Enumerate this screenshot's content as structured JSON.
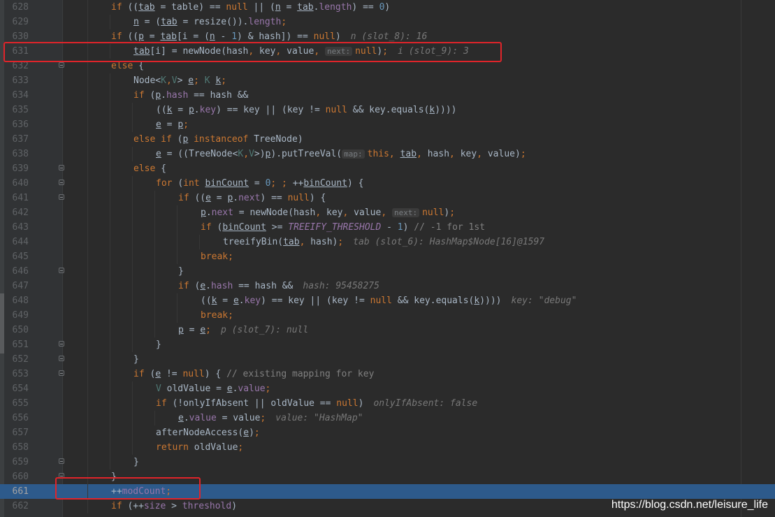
{
  "editor": {
    "language": "java",
    "current_line": 661,
    "lines": [
      {
        "n": "628",
        "indent": 2,
        "fold": false,
        "tokens": [
          [
            "kw",
            "if "
          ],
          [
            "p",
            "(("
          ],
          [
            "vu",
            "tab"
          ],
          [
            "p",
            " = table) == "
          ],
          [
            "kw",
            "null"
          ],
          [
            "p",
            " || ("
          ],
          [
            "vu",
            "n"
          ],
          [
            "p",
            " = "
          ],
          [
            "vu",
            "tab"
          ],
          [
            "p",
            "."
          ],
          [
            "fld",
            "length"
          ],
          [
            "p",
            ") == "
          ],
          [
            "num",
            "0"
          ],
          [
            "p",
            ")"
          ]
        ]
      },
      {
        "n": "629",
        "indent": 3,
        "fold": false,
        "tokens": [
          [
            "vu",
            "n"
          ],
          [
            "p",
            " = ("
          ],
          [
            "vu",
            "tab"
          ],
          [
            "p",
            " = resize())."
          ],
          [
            "fld",
            "length"
          ],
          [
            "kw",
            ";"
          ]
        ]
      },
      {
        "n": "630",
        "indent": 2,
        "fold": false,
        "tokens": [
          [
            "kw",
            "if "
          ],
          [
            "p",
            "(("
          ],
          [
            "vu",
            "p"
          ],
          [
            "p",
            " = "
          ],
          [
            "vu",
            "tab"
          ],
          [
            "p",
            "[i = ("
          ],
          [
            "vu",
            "n"
          ],
          [
            "p",
            " - "
          ],
          [
            "num",
            "1"
          ],
          [
            "p",
            ") & hash]) == "
          ],
          [
            "kw",
            "null"
          ],
          [
            "p",
            ")"
          ],
          [
            "inl",
            "n (slot_8): 16"
          ]
        ]
      },
      {
        "n": "631",
        "indent": 3,
        "fold": false,
        "tokens": [
          [
            "vu",
            "tab"
          ],
          [
            "p",
            "[i] = newNode(hash"
          ],
          [
            "kw",
            ", "
          ],
          [
            "p",
            "key"
          ],
          [
            "kw",
            ", "
          ],
          [
            "p",
            "value"
          ],
          [
            "kw",
            ", "
          ],
          [
            "hint",
            "next:"
          ],
          [
            "kw",
            "null"
          ],
          [
            "p",
            ")"
          ],
          [
            "kw",
            ";"
          ],
          [
            "inl",
            "i (slot_9): 3"
          ]
        ]
      },
      {
        "n": "632",
        "indent": 2,
        "fold": true,
        "tokens": [
          [
            "kw",
            "else "
          ],
          [
            "p",
            "{"
          ]
        ]
      },
      {
        "n": "633",
        "indent": 3,
        "fold": false,
        "tokens": [
          [
            "p",
            "Node<"
          ],
          [
            "gen",
            "K"
          ],
          [
            "kw",
            ","
          ],
          [
            "gen",
            "V"
          ],
          [
            "p",
            "> "
          ],
          [
            "vu",
            "e"
          ],
          [
            "kw",
            "; "
          ],
          [
            "gen",
            "K "
          ],
          [
            "vu",
            "k"
          ],
          [
            "kw",
            ";"
          ]
        ]
      },
      {
        "n": "634",
        "indent": 3,
        "fold": false,
        "tokens": [
          [
            "kw",
            "if "
          ],
          [
            "p",
            "("
          ],
          [
            "vu",
            "p"
          ],
          [
            "p",
            "."
          ],
          [
            "fld",
            "hash"
          ],
          [
            "p",
            " == hash &&"
          ]
        ]
      },
      {
        "n": "635",
        "indent": 4,
        "fold": false,
        "tokens": [
          [
            "p",
            "(("
          ],
          [
            "vu",
            "k"
          ],
          [
            "p",
            " = "
          ],
          [
            "vu",
            "p"
          ],
          [
            "p",
            "."
          ],
          [
            "fld",
            "key"
          ],
          [
            "p",
            ") == key || (key != "
          ],
          [
            "kw",
            "null"
          ],
          [
            "p",
            " && key.equals("
          ],
          [
            "vu",
            "k"
          ],
          [
            "p",
            "))))"
          ]
        ]
      },
      {
        "n": "636",
        "indent": 4,
        "fold": false,
        "tokens": [
          [
            "vu",
            "e"
          ],
          [
            "p",
            " = "
          ],
          [
            "vu",
            "p"
          ],
          [
            "kw",
            ";"
          ]
        ]
      },
      {
        "n": "637",
        "indent": 3,
        "fold": false,
        "tokens": [
          [
            "kw",
            "else if "
          ],
          [
            "p",
            "("
          ],
          [
            "vu",
            "p"
          ],
          [
            "kw",
            " instanceof "
          ],
          [
            "p",
            "TreeNode)"
          ]
        ]
      },
      {
        "n": "638",
        "indent": 4,
        "fold": false,
        "tokens": [
          [
            "vu",
            "e"
          ],
          [
            "p",
            " = ((TreeNode<"
          ],
          [
            "gen",
            "K"
          ],
          [
            "kw",
            ","
          ],
          [
            "gen",
            "V"
          ],
          [
            "p",
            ">)"
          ],
          [
            "vu",
            "p"
          ],
          [
            "p",
            ").putTreeVal("
          ],
          [
            "hint",
            "map:"
          ],
          [
            "kw",
            "this, "
          ],
          [
            "vu",
            "tab"
          ],
          [
            "kw",
            ", "
          ],
          [
            "p",
            "hash"
          ],
          [
            "kw",
            ", "
          ],
          [
            "p",
            "key"
          ],
          [
            "kw",
            ", "
          ],
          [
            "p",
            "value)"
          ],
          [
            "kw",
            ";"
          ]
        ]
      },
      {
        "n": "639",
        "indent": 3,
        "fold": true,
        "tokens": [
          [
            "kw",
            "else "
          ],
          [
            "p",
            "{"
          ]
        ]
      },
      {
        "n": "640",
        "indent": 4,
        "fold": true,
        "tokens": [
          [
            "kw",
            "for "
          ],
          [
            "p",
            "("
          ],
          [
            "kw",
            "int "
          ],
          [
            "vu",
            "binCount"
          ],
          [
            "p",
            " = "
          ],
          [
            "num",
            "0"
          ],
          [
            "kw",
            "; ; "
          ],
          [
            "p",
            "++"
          ],
          [
            "vu",
            "binCount"
          ],
          [
            "p",
            ") {"
          ]
        ]
      },
      {
        "n": "641",
        "indent": 5,
        "fold": true,
        "tokens": [
          [
            "kw",
            "if "
          ],
          [
            "p",
            "(("
          ],
          [
            "vu",
            "e"
          ],
          [
            "p",
            " = "
          ],
          [
            "vu",
            "p"
          ],
          [
            "p",
            "."
          ],
          [
            "fld",
            "next"
          ],
          [
            "p",
            ") == "
          ],
          [
            "kw",
            "null"
          ],
          [
            "p",
            ") {"
          ]
        ]
      },
      {
        "n": "642",
        "indent": 6,
        "fold": false,
        "tokens": [
          [
            "vu",
            "p"
          ],
          [
            "p",
            "."
          ],
          [
            "fld",
            "next"
          ],
          [
            "p",
            " = newNode(hash"
          ],
          [
            "kw",
            ", "
          ],
          [
            "p",
            "key"
          ],
          [
            "kw",
            ", "
          ],
          [
            "p",
            "value"
          ],
          [
            "kw",
            ", "
          ],
          [
            "hint",
            "next:"
          ],
          [
            "kw",
            "null"
          ],
          [
            "p",
            ")"
          ],
          [
            "kw",
            ";"
          ]
        ]
      },
      {
        "n": "643",
        "indent": 6,
        "fold": false,
        "tokens": [
          [
            "kw",
            "if "
          ],
          [
            "p",
            "("
          ],
          [
            "vu",
            "binCount"
          ],
          [
            "p",
            " >= "
          ],
          [
            "cst",
            "TREEIFY_THRESHOLD"
          ],
          [
            "p",
            " - "
          ],
          [
            "num",
            "1"
          ],
          [
            "p",
            ") "
          ],
          [
            "cmt",
            "// -1 for 1st"
          ]
        ]
      },
      {
        "n": "644",
        "indent": 7,
        "fold": false,
        "tokens": [
          [
            "p",
            "treeifyBin("
          ],
          [
            "vu",
            "tab"
          ],
          [
            "kw",
            ", "
          ],
          [
            "p",
            "hash)"
          ],
          [
            "kw",
            ";"
          ],
          [
            "inl",
            "tab (slot_6): HashMap$Node[16]@1597"
          ]
        ]
      },
      {
        "n": "645",
        "indent": 6,
        "fold": false,
        "tokens": [
          [
            "kw",
            "break;"
          ]
        ]
      },
      {
        "n": "646",
        "indent": 5,
        "fold": true,
        "tokens": [
          [
            "p",
            "}"
          ]
        ]
      },
      {
        "n": "647",
        "indent": 5,
        "fold": false,
        "tokens": [
          [
            "kw",
            "if "
          ],
          [
            "p",
            "("
          ],
          [
            "vu",
            "e"
          ],
          [
            "p",
            "."
          ],
          [
            "fld",
            "hash"
          ],
          [
            "p",
            " == hash &&"
          ],
          [
            "inl",
            "hash: 95458275"
          ]
        ]
      },
      {
        "n": "648",
        "indent": 6,
        "fold": false,
        "tokens": [
          [
            "p",
            "(("
          ],
          [
            "vu",
            "k"
          ],
          [
            "p",
            " = "
          ],
          [
            "vu",
            "e"
          ],
          [
            "p",
            "."
          ],
          [
            "fld",
            "key"
          ],
          [
            "p",
            ") == key || (key != "
          ],
          [
            "kw",
            "null"
          ],
          [
            "p",
            " && key.equals("
          ],
          [
            "vu",
            "k"
          ],
          [
            "p",
            "))))"
          ],
          [
            "inl",
            "key: \"debug\""
          ]
        ]
      },
      {
        "n": "649",
        "indent": 6,
        "fold": false,
        "tokens": [
          [
            "kw",
            "break;"
          ]
        ]
      },
      {
        "n": "650",
        "indent": 5,
        "fold": false,
        "tokens": [
          [
            "vu",
            "p"
          ],
          [
            "p",
            " = "
          ],
          [
            "vu",
            "e"
          ],
          [
            "kw",
            ";"
          ],
          [
            "inl",
            "p (slot_7): null"
          ]
        ]
      },
      {
        "n": "651",
        "indent": 4,
        "fold": true,
        "tokens": [
          [
            "p",
            "}"
          ]
        ]
      },
      {
        "n": "652",
        "indent": 3,
        "fold": true,
        "tokens": [
          [
            "p",
            "}"
          ]
        ]
      },
      {
        "n": "653",
        "indent": 3,
        "fold": true,
        "tokens": [
          [
            "kw",
            "if "
          ],
          [
            "p",
            "("
          ],
          [
            "vu",
            "e"
          ],
          [
            "p",
            " != "
          ],
          [
            "kw",
            "null"
          ],
          [
            "p",
            ") { "
          ],
          [
            "cmt",
            "// existing mapping for key"
          ]
        ]
      },
      {
        "n": "654",
        "indent": 4,
        "fold": false,
        "tokens": [
          [
            "gen",
            "V "
          ],
          [
            "p",
            "oldValue = "
          ],
          [
            "vu",
            "e"
          ],
          [
            "p",
            "."
          ],
          [
            "fld",
            "value"
          ],
          [
            "kw",
            ";"
          ]
        ]
      },
      {
        "n": "655",
        "indent": 4,
        "fold": false,
        "tokens": [
          [
            "kw",
            "if "
          ],
          [
            "p",
            "(!onlyIfAbsent || oldValue == "
          ],
          [
            "kw",
            "null"
          ],
          [
            "p",
            ")"
          ],
          [
            "inl",
            "onlyIfAbsent: false"
          ]
        ]
      },
      {
        "n": "656",
        "indent": 5,
        "fold": false,
        "tokens": [
          [
            "vu",
            "e"
          ],
          [
            "p",
            "."
          ],
          [
            "fld",
            "value"
          ],
          [
            "p",
            " = value"
          ],
          [
            "kw",
            ";"
          ],
          [
            "inl",
            "value: \"HashMap\""
          ]
        ]
      },
      {
        "n": "657",
        "indent": 4,
        "fold": false,
        "tokens": [
          [
            "p",
            "afterNodeAccess("
          ],
          [
            "vu",
            "e"
          ],
          [
            "p",
            ")"
          ],
          [
            "kw",
            ";"
          ]
        ]
      },
      {
        "n": "658",
        "indent": 4,
        "fold": false,
        "tokens": [
          [
            "kw",
            "return "
          ],
          [
            "p",
            "oldValue"
          ],
          [
            "kw",
            ";"
          ]
        ]
      },
      {
        "n": "659",
        "indent": 3,
        "fold": true,
        "tokens": [
          [
            "p",
            "}"
          ]
        ]
      },
      {
        "n": "660",
        "indent": 2,
        "fold": true,
        "tokens": [
          [
            "p",
            "}"
          ]
        ]
      },
      {
        "n": "661",
        "indent": 2,
        "fold": false,
        "tokens": [
          [
            "p",
            "++"
          ],
          [
            "fld",
            "modCount"
          ],
          [
            "kw",
            ";"
          ]
        ]
      },
      {
        "n": "662",
        "indent": 2,
        "fold": false,
        "tokens": [
          [
            "kw",
            "if "
          ],
          [
            "p",
            "(++"
          ],
          [
            "fld",
            "size"
          ],
          [
            "p",
            " > "
          ],
          [
            "fld",
            "threshold"
          ],
          [
            "p",
            ")"
          ]
        ]
      }
    ]
  },
  "watermark": "https://blog.csdn.net/leisure_life",
  "colors": {
    "background": "#2b2b2b",
    "gutter": "#313335",
    "keyword": "#cc7832",
    "field": "#9876aa",
    "number": "#6897bb",
    "comment": "#808080",
    "current_line": "#2d5a8b",
    "highlight_box": "#e0242a"
  }
}
